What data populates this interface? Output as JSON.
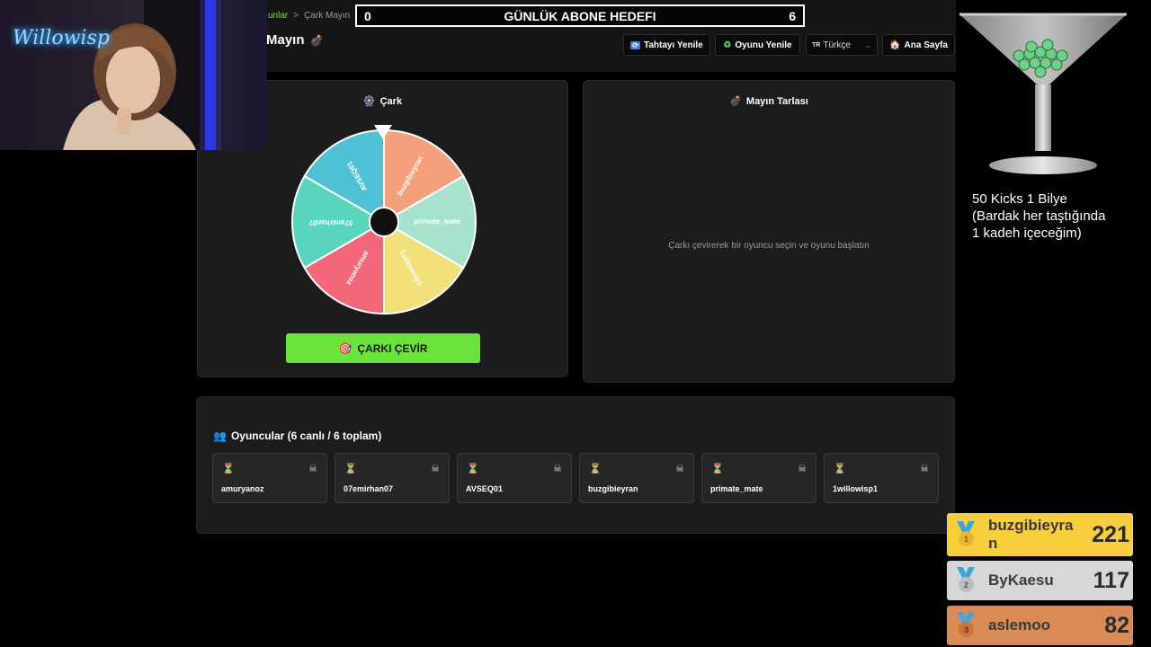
{
  "header": {
    "breadcrumb_link": "unlar",
    "breadcrumb_sep": ">",
    "breadcrumb_current": "Çark Mayın",
    "page_title": "Mayın",
    "page_title_icon": "bomb-icon"
  },
  "goal": {
    "title": "GÜNLÜK ABONE HEDEFI",
    "current": "0",
    "target": "6"
  },
  "toolbar": {
    "refresh_board_label": "Tahtayı Yenile",
    "refresh_game_label": "Oyunu Yenile",
    "language_code": "TR",
    "language_label": "Türkçe",
    "home_label": "Ana Sayfa"
  },
  "wheel_panel": {
    "title": "Çark",
    "spin_label": "ÇARKI ÇEVİR",
    "segments": [
      {
        "label": "buzgibieyran",
        "color": "#f5a07c"
      },
      {
        "label": "primate_mate",
        "color": "#a7e3cc"
      },
      {
        "label": "1willowisp1",
        "color": "#f2e07a"
      },
      {
        "label": "amuryanoz",
        "color": "#f2687a"
      },
      {
        "label": "07emirhan07",
        "color": "#58d5bd"
      },
      {
        "label": "AVSEQ01",
        "color": "#4ec2d4"
      }
    ]
  },
  "mine_panel": {
    "title": "Mayın Tarlası",
    "message": "Çarkı çevirerek bir oyuncu seçin ve oyunu başlatın"
  },
  "players": {
    "title": "Oyuncular (6 canlı / 6 toplam)",
    "list": [
      {
        "name": "amuryanoz"
      },
      {
        "name": "07emirhan07"
      },
      {
        "name": "AVSEQ01"
      },
      {
        "name": "buzgibieyran"
      },
      {
        "name": "primate_mate"
      },
      {
        "name": "1willowisp1"
      }
    ]
  },
  "overlay": {
    "streamer_neon": "Willowisp",
    "kicks_line1": "50 Kicks 1 Bilye",
    "kicks_line2": "(Bardak her taştığında",
    "kicks_line3": "1 kadeh içeceğim)"
  },
  "leaderboard": [
    {
      "rank": "1",
      "name": "buzgibieyran",
      "score": "221",
      "bg": "#f7cf3c"
    },
    {
      "rank": "2",
      "name": "ByKaesu",
      "score": "117",
      "bg": "#d7d7d7"
    },
    {
      "rank": "3",
      "name": "aslemoo",
      "score": "82",
      "bg": "#d98a55"
    }
  ]
}
